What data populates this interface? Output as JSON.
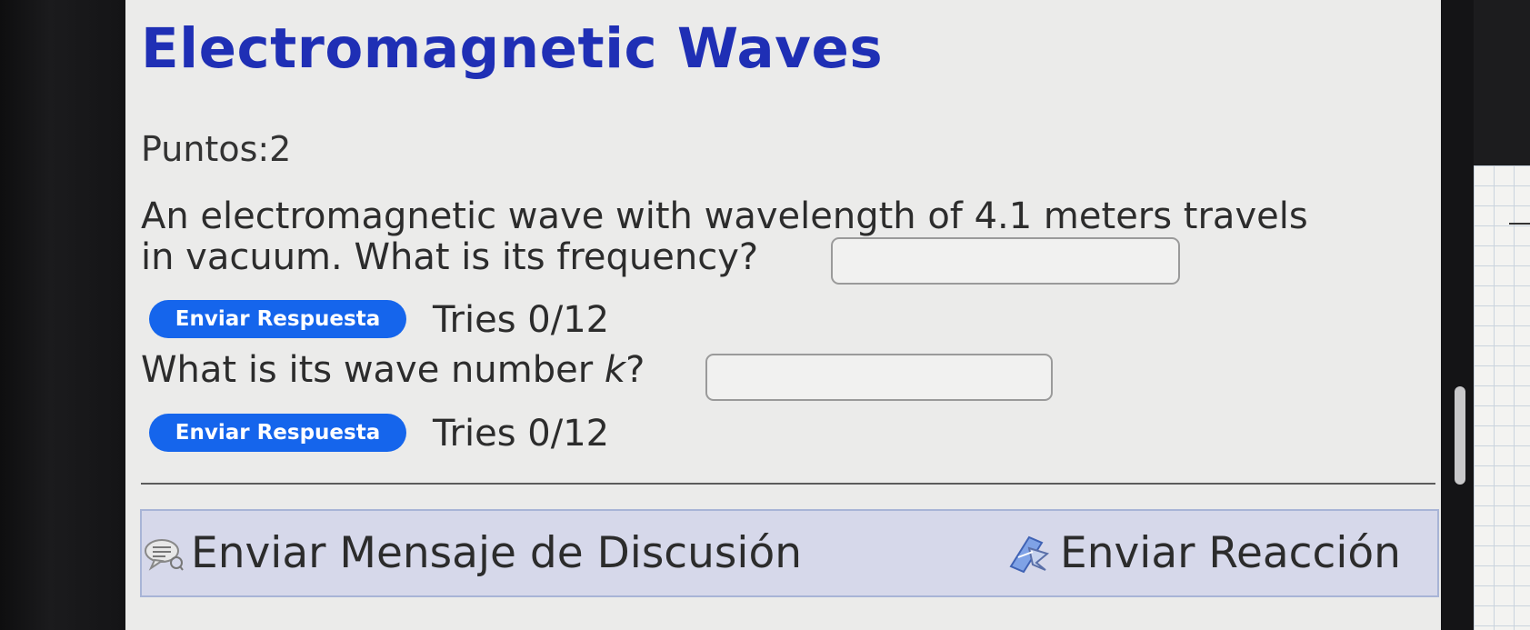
{
  "problem": {
    "title": "Electromagnetic Waves",
    "points": "Puntos:2",
    "question1_line1": "An electromagnetic wave with wavelength of 4.1 meters travels",
    "question1_line2": "in vacuum. What is its frequency?",
    "question1_answer": "",
    "submit1_label": "Enviar Respuesta",
    "tries1": "Tries 0/12",
    "question2_prefix": "What is its wave number ",
    "question2_var": "k",
    "question2_suffix": "?",
    "question2_answer": "",
    "submit2_label": "Enviar Respuesta",
    "tries2": "Tries 0/12"
  },
  "actions": {
    "discussion_label": "Enviar Mensaje de Discusión",
    "discussion_icon": "speech-bubble-icon",
    "reaction_label": "Enviar Reacción",
    "reaction_icon": "feedback-arrows-icon"
  },
  "colors": {
    "title": "#1f2fb5",
    "button": "#1565ec",
    "action_bar": "#d6d8ea"
  }
}
